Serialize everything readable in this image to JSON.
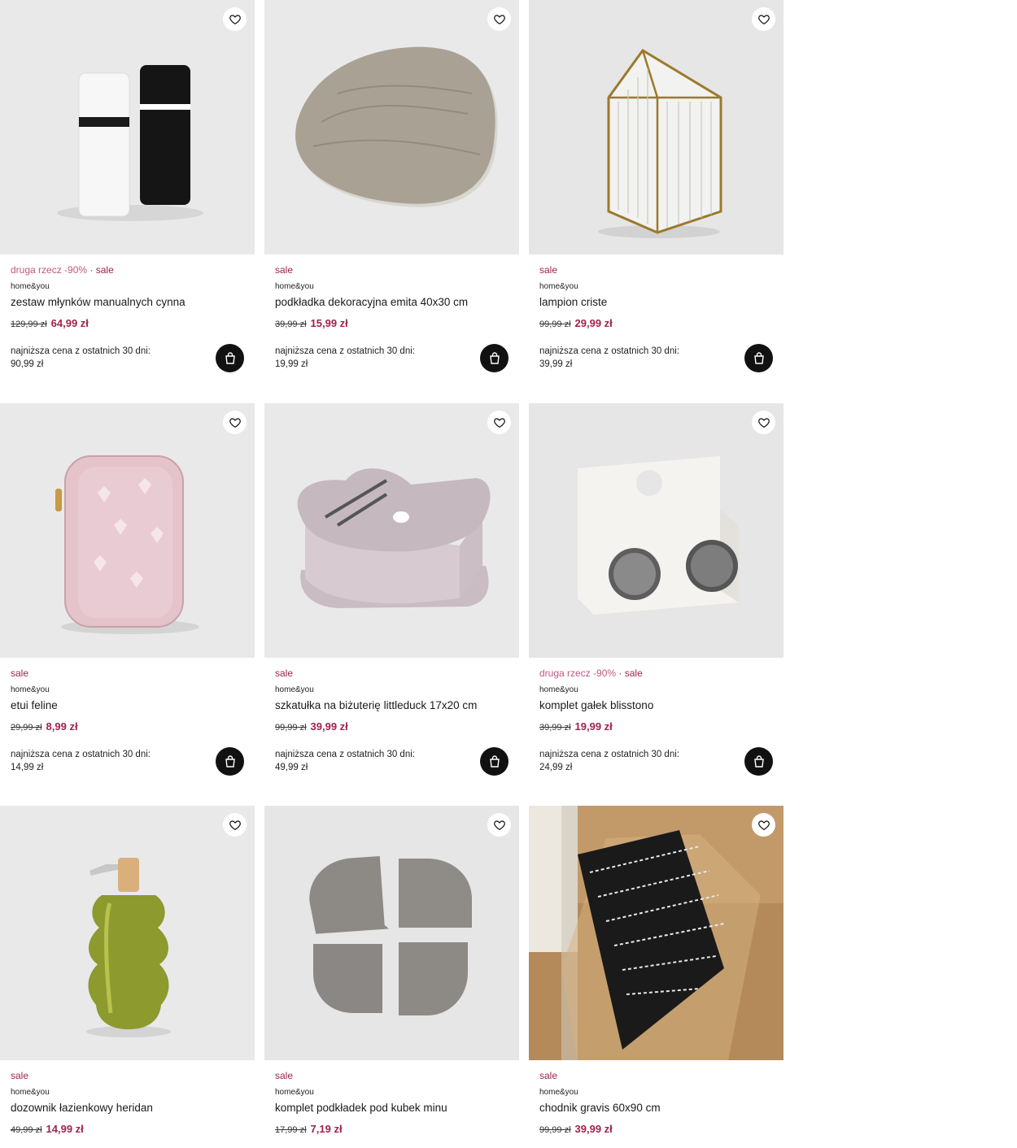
{
  "lowest_label": "najniższa cena z ostatnich 30 dni:",
  "products": [
    {
      "promo1": "druga rzecz -90%",
      "dot": "·",
      "promo2": "sale",
      "brand": "home&you",
      "name": "zestaw młynków manualnych cynna",
      "old_price": "129,99 zł",
      "new_price": "64,99 zł",
      "lowest_price": "90,99 zł",
      "icon": "salt-pepper-mills"
    },
    {
      "promo1": "",
      "dot": "",
      "promo2": "sale",
      "brand": "home&you",
      "name": "podkładka dekoracyjna emita 40x30 cm",
      "old_price": "39,99 zł",
      "new_price": "15,99 zł",
      "lowest_price": "19,99 zł",
      "icon": "wooden-placemat"
    },
    {
      "promo1": "",
      "dot": "",
      "promo2": "sale",
      "brand": "home&you",
      "name": "lampion criste",
      "old_price": "99,99 zł",
      "new_price": "29,99 zł",
      "lowest_price": "39,99 zł",
      "icon": "glass-house-lantern"
    },
    {
      "promo1": "",
      "dot": "",
      "promo2": "sale",
      "brand": "home&you",
      "name": "etui feline",
      "old_price": "29,99 zł",
      "new_price": "8,99 zł",
      "lowest_price": "14,99 zł",
      "icon": "pink-heart-case"
    },
    {
      "promo1": "",
      "dot": "",
      "promo2": "sale",
      "brand": "home&you",
      "name": "szkatułka na biżuterię littleduck 17x20 cm",
      "old_price": "99,99 zł",
      "new_price": "39,99 zł",
      "lowest_price": "49,99 zł",
      "icon": "heart-jewelry-box"
    },
    {
      "promo1": "druga rzecz -90%",
      "dot": "·",
      "promo2": "sale",
      "brand": "home&you",
      "name": "komplet gałek blisstono",
      "old_price": "39,99 zł",
      "new_price": "19,99 zł",
      "lowest_price": "24,99 zł",
      "icon": "marble-knobs"
    },
    {
      "promo1": "",
      "dot": "",
      "promo2": "sale",
      "brand": "home&you",
      "name": "dozownik łazienkowy heridan",
      "old_price": "49,99 zł",
      "new_price": "14,99 zł",
      "lowest_price": "",
      "icon": "green-soap-dispenser"
    },
    {
      "promo1": "",
      "dot": "",
      "promo2": "sale",
      "brand": "home&you",
      "name": "komplet podkładek pod kubek minu",
      "old_price": "17,99 zł",
      "new_price": "7,19 zł",
      "lowest_price": "",
      "icon": "gray-coasters"
    },
    {
      "promo1": "",
      "dot": "",
      "promo2": "sale",
      "brand": "home&you",
      "name": "chodnik gravis 60x90 cm",
      "old_price": "99,99 zł",
      "new_price": "39,99 zł",
      "lowest_price": "",
      "icon": "striped-rug"
    }
  ],
  "colors": {
    "sale": "#a0234f",
    "promo": "#c0577f",
    "cart_button": "#111111",
    "image_bg": "#e8e8e8"
  }
}
